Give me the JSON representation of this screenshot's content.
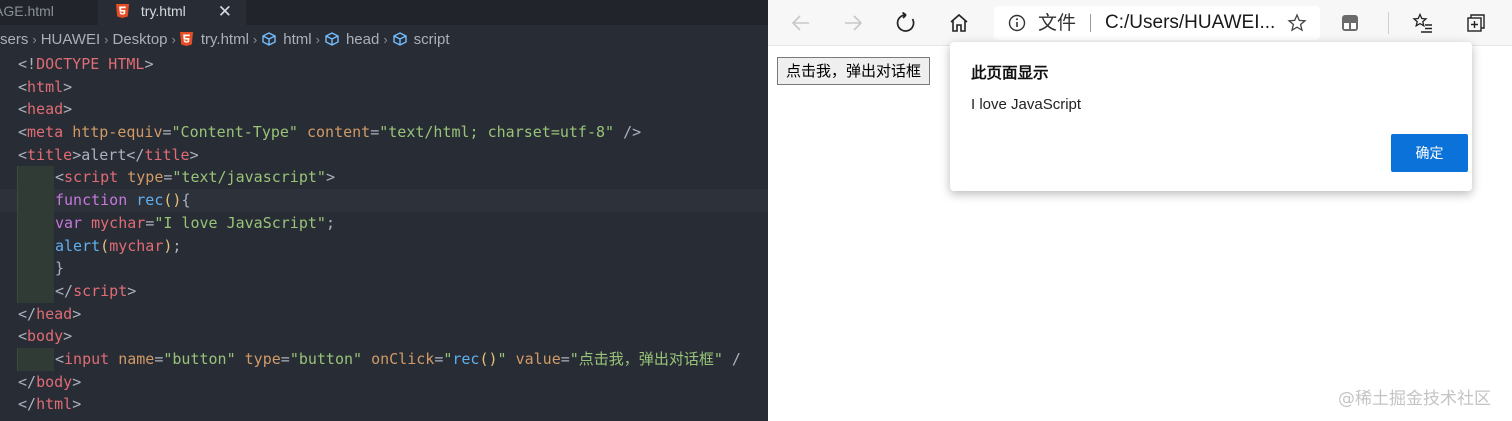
{
  "editor": {
    "tabs": [
      {
        "label": "AGE.html"
      },
      {
        "label": "try.html"
      }
    ],
    "breadcrumb": [
      "sers",
      "HUAWEI",
      "Desktop",
      "try.html",
      "html",
      "head",
      "script"
    ],
    "code_lines": [
      [
        [
          "punc",
          "<!"
        ],
        [
          "tag",
          "DOCTYPE HTML"
        ],
        [
          "punc",
          ">"
        ]
      ],
      [
        [
          "punc",
          "<"
        ],
        [
          "tag",
          "html"
        ],
        [
          "punc",
          ">"
        ]
      ],
      [
        [
          "punc",
          "<"
        ],
        [
          "tag",
          "head"
        ],
        [
          "punc",
          ">"
        ]
      ],
      [
        [
          "punc",
          "<"
        ],
        [
          "tag",
          "meta"
        ],
        [
          "plain",
          " "
        ],
        [
          "attr",
          "http-equiv"
        ],
        [
          "punc",
          "="
        ],
        [
          "str",
          "\"Content-Type\""
        ],
        [
          "plain",
          " "
        ],
        [
          "attr",
          "content"
        ],
        [
          "punc",
          "="
        ],
        [
          "str",
          "\"text/html; charset=utf-8\""
        ],
        [
          "plain",
          " />"
        ]
      ],
      [
        [
          "punc",
          "<"
        ],
        [
          "tag",
          "title"
        ],
        [
          "punc",
          ">"
        ],
        [
          "plain",
          "alert"
        ],
        [
          "punc",
          "</"
        ],
        [
          "tag",
          "title"
        ],
        [
          "punc",
          ">"
        ]
      ],
      [
        [
          "punc",
          "<"
        ],
        [
          "tag",
          "script"
        ],
        [
          "plain",
          " "
        ],
        [
          "attr",
          "type"
        ],
        [
          "punc",
          "="
        ],
        [
          "str",
          "\"text/javascript\""
        ],
        [
          "punc",
          ">"
        ]
      ],
      [
        [
          "kw",
          "function"
        ],
        [
          "plain",
          " "
        ],
        [
          "fn",
          "rec"
        ],
        [
          "paren",
          "()"
        ],
        [
          "punc",
          "{"
        ]
      ],
      [
        [
          "kw",
          "var"
        ],
        [
          "plain",
          " "
        ],
        [
          "var",
          "mychar"
        ],
        [
          "punc",
          "="
        ],
        [
          "str",
          "\"I love JavaScript\""
        ],
        [
          "punc",
          ";"
        ]
      ],
      [
        [
          "fn",
          "alert"
        ],
        [
          "paren",
          "("
        ],
        [
          "var",
          "mychar"
        ],
        [
          "paren",
          ")"
        ],
        [
          "punc",
          ";"
        ]
      ],
      [
        [
          "punc",
          "}"
        ]
      ],
      [
        [
          "punc",
          "</"
        ],
        [
          "tag",
          "script"
        ],
        [
          "punc",
          ">"
        ]
      ],
      [
        [
          "punc",
          "</"
        ],
        [
          "tag",
          "head"
        ],
        [
          "punc",
          ">"
        ]
      ],
      [
        [
          "punc",
          "<"
        ],
        [
          "tag",
          "body"
        ],
        [
          "punc",
          ">"
        ]
      ],
      [
        [
          "punc",
          "<"
        ],
        [
          "tag",
          "input"
        ],
        [
          "plain",
          " "
        ],
        [
          "attr",
          "name"
        ],
        [
          "punc",
          "="
        ],
        [
          "str",
          "\"button\""
        ],
        [
          "plain",
          " "
        ],
        [
          "attr",
          "type"
        ],
        [
          "punc",
          "="
        ],
        [
          "str",
          "\"button\""
        ],
        [
          "plain",
          " "
        ],
        [
          "attr",
          "onClick"
        ],
        [
          "punc",
          "="
        ],
        [
          "str",
          "\""
        ],
        [
          "fn",
          "rec"
        ],
        [
          "paren",
          "()"
        ],
        [
          "str",
          "\""
        ],
        [
          "plain",
          " "
        ],
        [
          "attr",
          "value"
        ],
        [
          "punc",
          "="
        ],
        [
          "str",
          "\"点击我，弹出对话框\""
        ],
        [
          "plain",
          " /"
        ]
      ],
      [
        [
          "punc",
          "</"
        ],
        [
          "tag",
          "body"
        ],
        [
          "punc",
          ">"
        ]
      ],
      [
        [
          "punc",
          "</"
        ],
        [
          "tag",
          "html"
        ],
        [
          "punc",
          ">"
        ]
      ]
    ]
  },
  "browser": {
    "address_label": "文件",
    "address_url": "C:/Users/HUAWEI...",
    "page_button_label": "点击我，弹出对话框",
    "dialog": {
      "title": "此页面显示",
      "message": "I love JavaScript",
      "ok_label": "确定"
    }
  },
  "watermark": "@稀土掘金技术社区",
  "colors": {
    "editor_bg": "#282c34",
    "tag": "#e06c75",
    "attr": "#d19a66",
    "string": "#98c379",
    "keyword": "#c678dd",
    "function": "#61afef",
    "accent_button": "#0a72d8"
  }
}
